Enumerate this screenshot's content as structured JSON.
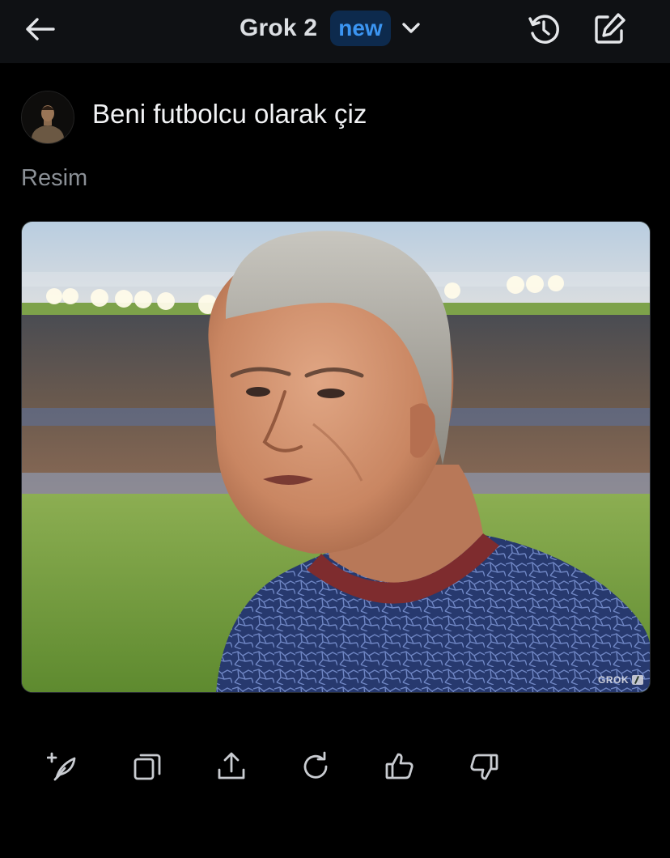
{
  "header": {
    "title": "Grok 2",
    "badge": "new",
    "icons": {
      "back": "arrow-left-icon",
      "dropdown": "chevron-down-icon",
      "history": "history-icon",
      "compose": "compose-icon"
    }
  },
  "message": {
    "prompt": "Beni futbolcu olarak çiz",
    "section_label": "Resim",
    "image_watermark": "GROK"
  },
  "actions": [
    {
      "icon": "regenerate-sparkle-icon"
    },
    {
      "icon": "copy-icon"
    },
    {
      "icon": "share-icon"
    },
    {
      "icon": "refresh-icon"
    },
    {
      "icon": "thumbs-up-icon"
    },
    {
      "icon": "thumbs-down-icon"
    }
  ],
  "colors": {
    "background": "#000000",
    "topbar": "#0f1114",
    "badge_bg": "#0d2a4d",
    "badge_text": "#3b95f2",
    "muted_text": "#8b9096",
    "icon_color": "#c9ccd1"
  }
}
